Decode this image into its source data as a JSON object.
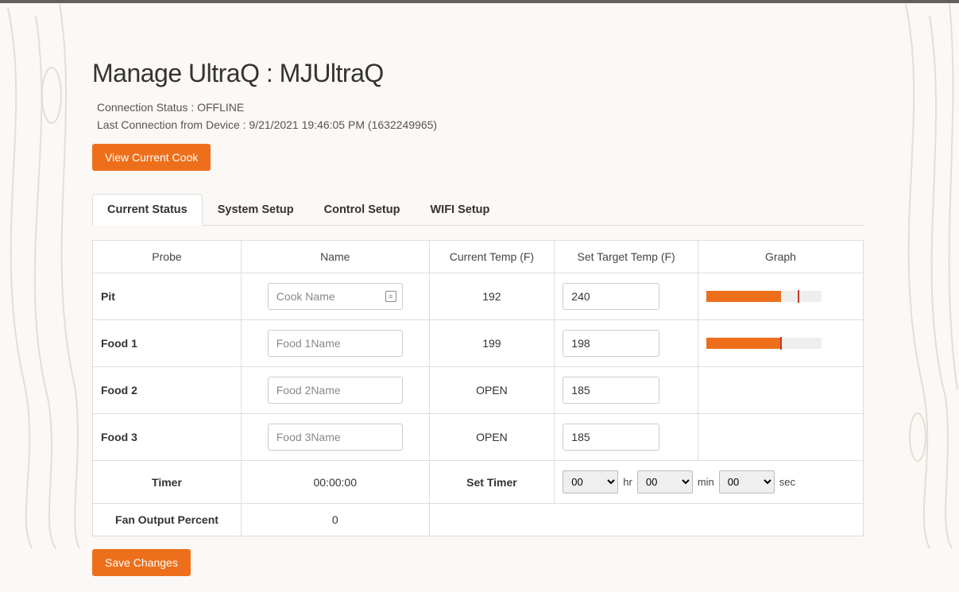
{
  "header": {
    "title": "Manage UltraQ : MJUltraQ",
    "connection_status": "Connection Status : OFFLINE",
    "last_connection": "Last Connection from Device : 9/21/2021 19:46:05 PM (1632249965)",
    "view_cook_label": "View Current Cook"
  },
  "tabs": [
    {
      "label": "Current Status",
      "active": true
    },
    {
      "label": "System Setup",
      "active": false
    },
    {
      "label": "Control Setup",
      "active": false
    },
    {
      "label": "WIFI Setup",
      "active": false
    }
  ],
  "table": {
    "headers": [
      "Probe",
      "Name",
      "Current Temp (F)",
      "Set Target Temp (F)",
      "Graph"
    ],
    "rows": [
      {
        "probe": "Pit",
        "name_placeholder": "Cook Name",
        "name_value": "",
        "current": "192",
        "target": "240",
        "graph_fill_pct": 65,
        "graph_tick_pct": 79,
        "has_icon": true
      },
      {
        "probe": "Food 1",
        "name_placeholder": "Food 1Name",
        "name_value": "",
        "current": "199",
        "target": "198",
        "graph_fill_pct": 64,
        "graph_tick_pct": 64,
        "has_icon": false
      },
      {
        "probe": "Food 2",
        "name_placeholder": "Food 2Name",
        "name_value": "",
        "current": "OPEN",
        "target": "185",
        "graph_fill_pct": null,
        "graph_tick_pct": null,
        "has_icon": false
      },
      {
        "probe": "Food 3",
        "name_placeholder": "Food 3Name",
        "name_value": "",
        "current": "OPEN",
        "target": "185",
        "graph_fill_pct": null,
        "graph_tick_pct": null,
        "has_icon": false
      }
    ],
    "timer": {
      "label": "Timer",
      "value": "00:00:00",
      "set_label": "Set Timer",
      "hr": "00",
      "min": "00",
      "sec": "00",
      "hr_unit": "hr",
      "min_unit": "min",
      "sec_unit": "sec"
    },
    "fan": {
      "label": "Fan Output Percent",
      "value": "0"
    }
  },
  "save_label": "Save Changes"
}
